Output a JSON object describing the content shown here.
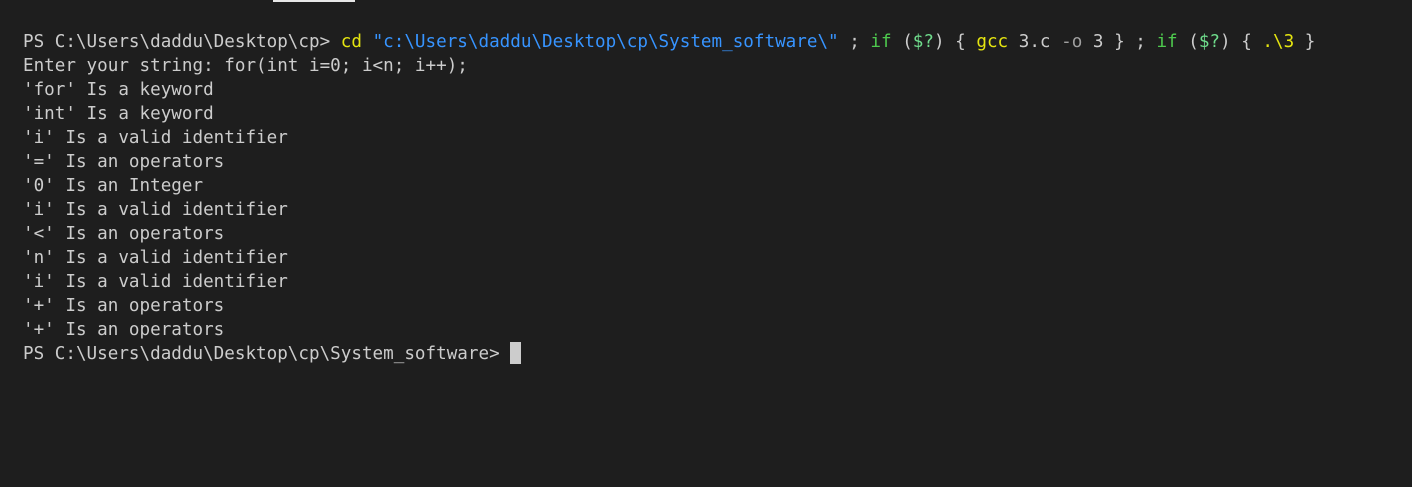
{
  "terminal": {
    "command_line": {
      "prompt": "PS C:\\Users\\daddu\\Desktop\\cp> ",
      "cd": "cd",
      "space1": " ",
      "path": "\"c:\\Users\\daddu\\Desktop\\cp\\System_software\\\"",
      "sep1": " ; ",
      "if1": "if",
      "space2": " (",
      "status1": "$?",
      "brace1": ") { ",
      "gcc": "gcc",
      "args": " 3.c ",
      "flag": "-o",
      "out": " 3 } ; ",
      "if2": "if",
      "space3": " (",
      "status2": "$?",
      "brace2": ") { ",
      "exe": ".\\3",
      "end": " }"
    },
    "output_lines": [
      "Enter your string: for(int i=0; i<n; i++);",
      "'for' Is a keyword",
      "'int' Is a keyword",
      "'i' Is a valid identifier",
      "'=' Is an operators",
      "'0' Is an Integer",
      "'i' Is a valid identifier",
      "'<' Is an operators",
      "'n' Is a valid identifier",
      "'i' Is a valid identifier",
      "'+' Is an operators",
      "'+' Is an operators"
    ],
    "final_prompt": "PS C:\\Users\\daddu\\Desktop\\cp\\System_software> "
  },
  "colors": {
    "background": "#1e1e1e",
    "text": "#cccccc",
    "string": "#3794ff",
    "keyword": "#4ec94e",
    "command": "#e5e510"
  }
}
